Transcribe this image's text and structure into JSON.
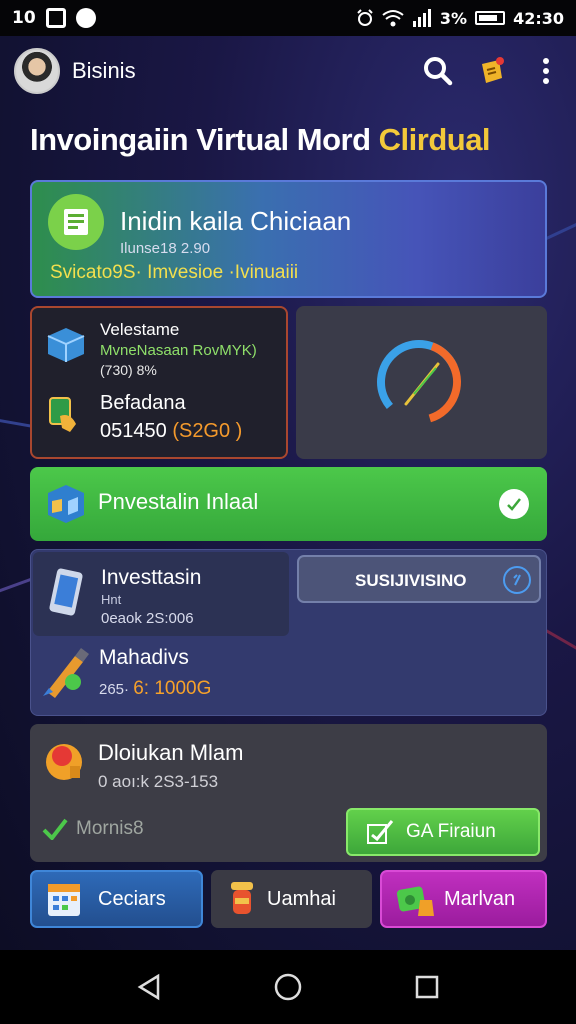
{
  "status_bar": {
    "left_text": "10",
    "battery_percent": "3%",
    "time": "42:30",
    "icons": [
      "sd-card-icon",
      "photo-icon",
      "messenger-icon",
      "alarm-icon",
      "wifi-icon",
      "signal-icon",
      "battery-icon"
    ]
  },
  "app_bar": {
    "title": "Bisinis",
    "actions": [
      "search-icon",
      "notification-icon",
      "more-vert-icon"
    ]
  },
  "headline": {
    "text": "Invoingaiin Virtual Mord",
    "accent": "Clirdual"
  },
  "hero": {
    "title": "Inidin kaila Chiciaan",
    "subtitle": "Ilunse18 2.90",
    "info": "Svicato9S· Imvesioe ·Ivinuaiii"
  },
  "stats": {
    "item1_label": "Velestame",
    "item1_green": "MvneNasaan RovMYK)",
    "item1_sub": "(730) 8%",
    "item2_label": "Befadana",
    "item2_value": "051450",
    "item2_value_accent": "(S2G0 )"
  },
  "gauge": {
    "level": 0.72,
    "colors": [
      "#3aa1e8",
      "#f26a2a"
    ]
  },
  "invest_initial": {
    "label": "Pnvestalin Inlaal"
  },
  "invest_panel": {
    "row1_label": "Investtasin",
    "row1_small": "Hnt",
    "row1_value": "0eaok 2S:006",
    "subscribe_label": "SUSIJIVISINO",
    "row2_label": "Mahadivs",
    "row2_value": "265· ",
    "row2_value_accent": "6: 1000G"
  },
  "dividend": {
    "title": "Dloiukan Mlam",
    "value": "0 aoı:k 2S3-153",
    "status": "Mornis8",
    "action": "GA Firaiun"
  },
  "bottom_buttons": [
    {
      "label": "Ceciars"
    },
    {
      "label": "Uamhai"
    },
    {
      "label": "Marlvan"
    }
  ],
  "accent_colors": {
    "green": "#4cc84a",
    "yellow": "#f3c93a",
    "magenta": "#c02fbf",
    "blue": "#2e6ab8"
  }
}
